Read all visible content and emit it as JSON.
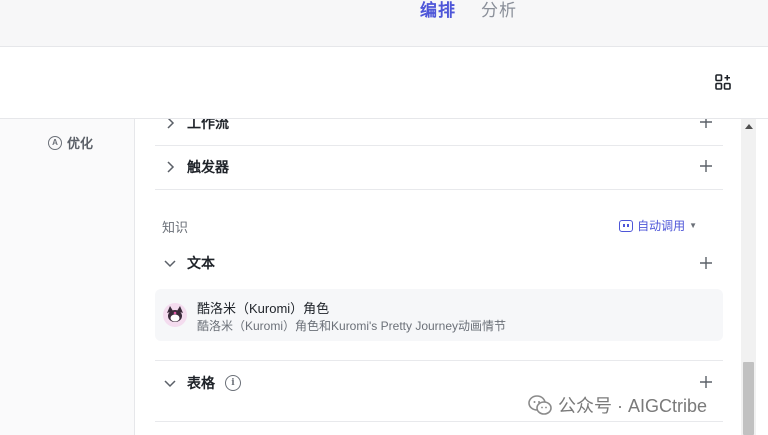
{
  "header": {
    "tabs": [
      {
        "label": "编排",
        "active": true
      },
      {
        "label": "分析",
        "active": false
      }
    ],
    "accent_color": "#4e56d8"
  },
  "toolbar": {
    "layout_icon": "grid-plus-icon"
  },
  "leftnav": {
    "items": [
      {
        "label": "优化",
        "icon": "a-circle-icon"
      }
    ]
  },
  "main": {
    "rows_top": [
      {
        "label": "工作流",
        "icon": "chevron-right-icon"
      },
      {
        "label": "触发器",
        "icon": "chevron-right-icon"
      }
    ],
    "knowledge": {
      "section_title": "知识",
      "auto_call_label": "自动调用",
      "text_group": {
        "label": "文本",
        "items": [
          {
            "title": "酷洛米（Kuromi）角色",
            "description": "酷洛米（Kuromi）角色和Kuromi's Pretty Journey动画情节"
          }
        ]
      },
      "table_group": {
        "label": "表格"
      }
    }
  },
  "watermark": {
    "text": "公众号 · AIGCtribe"
  }
}
